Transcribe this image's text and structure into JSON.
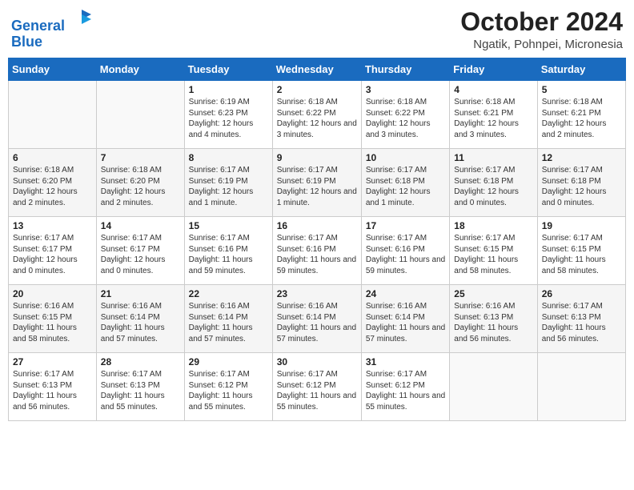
{
  "header": {
    "logo_line1": "General",
    "logo_line2": "Blue",
    "month": "October 2024",
    "location": "Ngatik, Pohnpei, Micronesia"
  },
  "weekdays": [
    "Sunday",
    "Monday",
    "Tuesday",
    "Wednesday",
    "Thursday",
    "Friday",
    "Saturday"
  ],
  "weeks": [
    [
      {
        "day": "",
        "info": ""
      },
      {
        "day": "",
        "info": ""
      },
      {
        "day": "1",
        "info": "Sunrise: 6:19 AM\nSunset: 6:23 PM\nDaylight: 12 hours and 4 minutes."
      },
      {
        "day": "2",
        "info": "Sunrise: 6:18 AM\nSunset: 6:22 PM\nDaylight: 12 hours and 3 minutes."
      },
      {
        "day": "3",
        "info": "Sunrise: 6:18 AM\nSunset: 6:22 PM\nDaylight: 12 hours and 3 minutes."
      },
      {
        "day": "4",
        "info": "Sunrise: 6:18 AM\nSunset: 6:21 PM\nDaylight: 12 hours and 3 minutes."
      },
      {
        "day": "5",
        "info": "Sunrise: 6:18 AM\nSunset: 6:21 PM\nDaylight: 12 hours and 2 minutes."
      }
    ],
    [
      {
        "day": "6",
        "info": "Sunrise: 6:18 AM\nSunset: 6:20 PM\nDaylight: 12 hours and 2 minutes."
      },
      {
        "day": "7",
        "info": "Sunrise: 6:18 AM\nSunset: 6:20 PM\nDaylight: 12 hours and 2 minutes."
      },
      {
        "day": "8",
        "info": "Sunrise: 6:17 AM\nSunset: 6:19 PM\nDaylight: 12 hours and 1 minute."
      },
      {
        "day": "9",
        "info": "Sunrise: 6:17 AM\nSunset: 6:19 PM\nDaylight: 12 hours and 1 minute."
      },
      {
        "day": "10",
        "info": "Sunrise: 6:17 AM\nSunset: 6:18 PM\nDaylight: 12 hours and 1 minute."
      },
      {
        "day": "11",
        "info": "Sunrise: 6:17 AM\nSunset: 6:18 PM\nDaylight: 12 hours and 0 minutes."
      },
      {
        "day": "12",
        "info": "Sunrise: 6:17 AM\nSunset: 6:18 PM\nDaylight: 12 hours and 0 minutes."
      }
    ],
    [
      {
        "day": "13",
        "info": "Sunrise: 6:17 AM\nSunset: 6:17 PM\nDaylight: 12 hours and 0 minutes."
      },
      {
        "day": "14",
        "info": "Sunrise: 6:17 AM\nSunset: 6:17 PM\nDaylight: 12 hours and 0 minutes."
      },
      {
        "day": "15",
        "info": "Sunrise: 6:17 AM\nSunset: 6:16 PM\nDaylight: 11 hours and 59 minutes."
      },
      {
        "day": "16",
        "info": "Sunrise: 6:17 AM\nSunset: 6:16 PM\nDaylight: 11 hours and 59 minutes."
      },
      {
        "day": "17",
        "info": "Sunrise: 6:17 AM\nSunset: 6:16 PM\nDaylight: 11 hours and 59 minutes."
      },
      {
        "day": "18",
        "info": "Sunrise: 6:17 AM\nSunset: 6:15 PM\nDaylight: 11 hours and 58 minutes."
      },
      {
        "day": "19",
        "info": "Sunrise: 6:17 AM\nSunset: 6:15 PM\nDaylight: 11 hours and 58 minutes."
      }
    ],
    [
      {
        "day": "20",
        "info": "Sunrise: 6:16 AM\nSunset: 6:15 PM\nDaylight: 11 hours and 58 minutes."
      },
      {
        "day": "21",
        "info": "Sunrise: 6:16 AM\nSunset: 6:14 PM\nDaylight: 11 hours and 57 minutes."
      },
      {
        "day": "22",
        "info": "Sunrise: 6:16 AM\nSunset: 6:14 PM\nDaylight: 11 hours and 57 minutes."
      },
      {
        "day": "23",
        "info": "Sunrise: 6:16 AM\nSunset: 6:14 PM\nDaylight: 11 hours and 57 minutes."
      },
      {
        "day": "24",
        "info": "Sunrise: 6:16 AM\nSunset: 6:14 PM\nDaylight: 11 hours and 57 minutes."
      },
      {
        "day": "25",
        "info": "Sunrise: 6:16 AM\nSunset: 6:13 PM\nDaylight: 11 hours and 56 minutes."
      },
      {
        "day": "26",
        "info": "Sunrise: 6:17 AM\nSunset: 6:13 PM\nDaylight: 11 hours and 56 minutes."
      }
    ],
    [
      {
        "day": "27",
        "info": "Sunrise: 6:17 AM\nSunset: 6:13 PM\nDaylight: 11 hours and 56 minutes."
      },
      {
        "day": "28",
        "info": "Sunrise: 6:17 AM\nSunset: 6:13 PM\nDaylight: 11 hours and 55 minutes."
      },
      {
        "day": "29",
        "info": "Sunrise: 6:17 AM\nSunset: 6:12 PM\nDaylight: 11 hours and 55 minutes."
      },
      {
        "day": "30",
        "info": "Sunrise: 6:17 AM\nSunset: 6:12 PM\nDaylight: 11 hours and 55 minutes."
      },
      {
        "day": "31",
        "info": "Sunrise: 6:17 AM\nSunset: 6:12 PM\nDaylight: 11 hours and 55 minutes."
      },
      {
        "day": "",
        "info": ""
      },
      {
        "day": "",
        "info": ""
      }
    ]
  ]
}
